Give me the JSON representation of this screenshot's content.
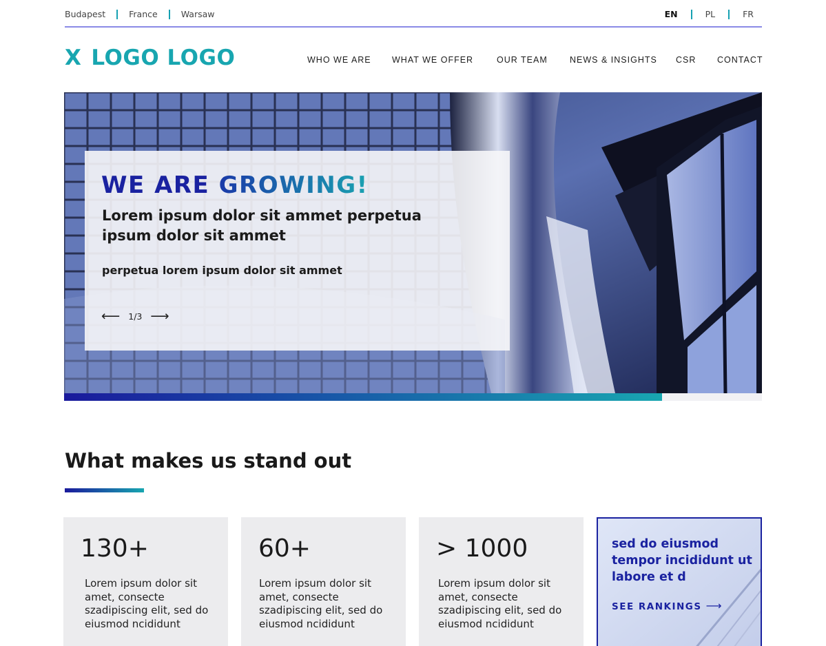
{
  "topbar": {
    "cities": [
      "Budapest",
      "France",
      "Warsaw"
    ],
    "languages": [
      "EN",
      "PL",
      "FR"
    ],
    "active_language": "EN"
  },
  "header": {
    "logo_mark": "X",
    "logo_text": "LOGO LOGO",
    "nav": [
      "WHO WE ARE",
      "WHAT WE OFFER",
      "OUR TEAM",
      "NEWS & INSIGHTS",
      "CSR",
      "CONTACT"
    ]
  },
  "hero": {
    "title_part1": "WE ARE",
    "title_part2": "GROWING!",
    "subtitle": "Lorem ipsum dolor sit ammet perpetua ipsum dolor sit ammet",
    "small_text": "perpetua lorem ipsum dolor sit ammet",
    "pager": "1/3",
    "prev_icon": "arrow-left-icon",
    "next_icon": "arrow-right-icon",
    "progress": 0.857
  },
  "section": {
    "title": "What makes us stand out"
  },
  "stats": [
    {
      "value": "130+",
      "text": "Lorem ipsum dolor sit amet, consecte szadipiscing elit, sed do eiusmod ncididunt"
    },
    {
      "value": "60+",
      "text": "Lorem ipsum dolor sit amet, consecte szadipiscing elit, sed do eiusmod ncididunt"
    },
    {
      "value": "> 1000",
      "text": "Lorem ipsum dolor sit amet, consecte szadipiscing elit, sed do eiusmod ncididunt"
    }
  ],
  "rankings": {
    "text": "sed do eiusmod tempor incididunt ut labore et d",
    "link": "SEE RANKINGS",
    "link_icon": "arrow-right-icon"
  },
  "colors": {
    "teal": "#18a6b0",
    "navy": "#1a22a0",
    "card_gray": "#ececee"
  }
}
